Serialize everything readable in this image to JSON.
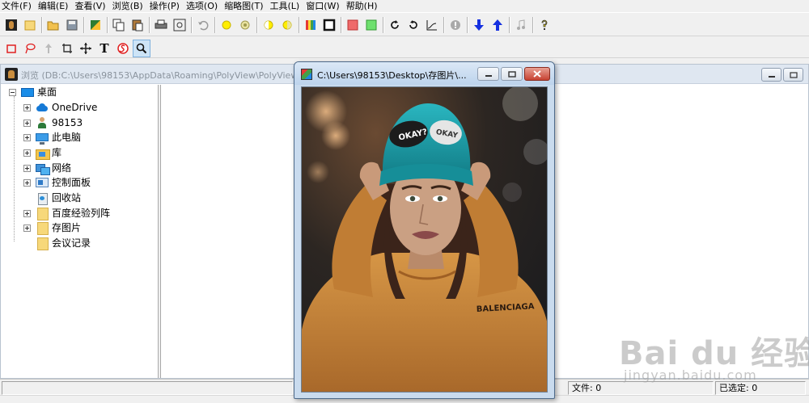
{
  "menubar": {
    "items": [
      "文件(F)",
      "编辑(E)",
      "查看(V)",
      "浏览(B)",
      "操作(P)",
      "选项(O)",
      "缩略图(T)",
      "工具(L)",
      "窗口(W)",
      "帮助(H)"
    ]
  },
  "toolbar1": {
    "buttons": [
      "app-logo-icon",
      "new-folder-icon",
      "open-icon",
      "save-icon",
      "image-effect-icon",
      "copy-icon",
      "paste-icon",
      "print-icon",
      "fit-screen-icon",
      "undo-icon",
      "sun-icon",
      "contrast-icon",
      "half-circle-icon",
      "half-moon-icon",
      "color-palette-icon",
      "frame-icon",
      "red-square-icon",
      "green-square-icon",
      "rotate-right-icon",
      "rotate-left-icon",
      "curve-icon",
      "info-icon",
      "arrow-down-icon",
      "arrow-up-icon",
      "music-note-icon",
      "help-icon"
    ]
  },
  "toolbar2": {
    "buttons": [
      "rectangle-tool-icon",
      "lasso-tool-icon",
      "pointer-tool-icon",
      "crop-tool-icon",
      "move-tool-icon",
      "text-tool-icon",
      "stamp-tool-icon",
      "zoom-tool-icon"
    ],
    "text_tool_glyph": "T"
  },
  "browse_window": {
    "title": "浏览 (DB:C:\\Users\\98153\\AppData\\Roaming\\PolyView\\PolyView"
  },
  "tree": {
    "root": "桌面",
    "items": [
      "OneDrive",
      "98153",
      "此电脑",
      "库",
      "网络",
      "控制面板",
      "回收站",
      "百度经验列阵",
      "存图片",
      "会议记录"
    ]
  },
  "status": {
    "files": "文件: 0",
    "selected": "已选定: 0"
  },
  "viewer": {
    "title": "C:\\Users\\98153\\Desktop\\存图片\\...",
    "hat_text_1": "OKAY?",
    "hat_text_2": "OKAY",
    "shirt_text": "BALENCIAGA"
  },
  "watermark": {
    "main": "Bai du 经验",
    "sub": "jingyan.baidu.com"
  },
  "colors": {
    "sweater": "#c98a3c",
    "beanie": "#1fa2ad",
    "title_bar": "#dfe7f1"
  }
}
